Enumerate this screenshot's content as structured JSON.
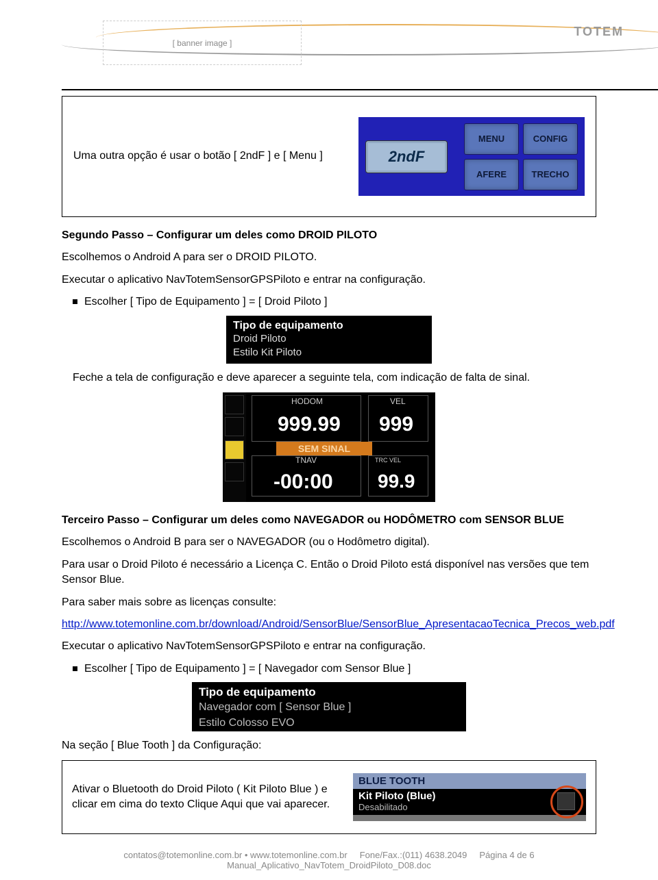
{
  "header": {
    "brand": "TOTEM",
    "logo_placeholder": "[ banner image ]"
  },
  "section1": {
    "title_text": "Uma outra opção é usar o botão [ 2ndF ] e [ Menu ]",
    "btn_2ndf": "2ndF",
    "menu_buttons": {
      "tl": "MENU",
      "tr": "CONFIG",
      "bl": "AFERE",
      "br": "TRECHO"
    }
  },
  "passo2": {
    "heading": "Segundo Passo – Configurar um deles como DROID PILOTO",
    "line1": "Escolhemos o Android A para ser o DROID PILOTO.",
    "line2": "Executar o aplicativo NavTotemSensorGPSPiloto e entrar na configuração.",
    "bullet1": "Escolher [ Tipo de Equipamento ] = [ Droid Piloto ]",
    "tipo1": {
      "title": "Tipo de equipamento",
      "opt1": "Droid Piloto",
      "opt2": "Estilo Kit Piloto"
    },
    "line3": "Feche a tela de configuração e deve aparecer a seguinte tela, com indicação de falta de sinal."
  },
  "display": {
    "hodom_label": "HODOM",
    "hodom_value": "999.99",
    "vel_label": "VEL",
    "vel_value": "999",
    "sem_sinal": "SEM SINAL",
    "tnav_label": "TNAV",
    "tnav_value": "-00:00",
    "trcvel_label": "TRC VEL",
    "trcvel_value": "99.9"
  },
  "passo3": {
    "heading": "Terceiro Passo – Configurar um deles como NAVEGADOR ou HODÔMETRO com SENSOR BLUE",
    "line1": "Escolhemos o Android B para ser o NAVEGADOR (ou o Hodômetro digital).",
    "line2": "Para usar o Droid Piloto é necessário a Licença C. Então o Droid Piloto está disponível nas versões que tem Sensor Blue.",
    "line3": "Para saber mais sobre as licenças consulte:",
    "link": "http://www.totemonline.com.br/download/Android/SensorBlue/SensorBlue_ApresentacaoTecnica_Precos_web.pdf",
    "line4": "Executar o aplicativo NavTotemSensorGPSPiloto e entrar na configuração.",
    "bullet1": "Escolher [ Tipo de Equipamento ] = [ Navegador com Sensor Blue ]",
    "tipo2": {
      "title": "Tipo de equipamento",
      "opt1": "Navegador com [ Sensor Blue ]",
      "opt2": "Estilo Colosso EVO"
    },
    "line5": "Na seção [ Blue Tooth ] da Configuração:"
  },
  "bluetooth_box": {
    "text": "Ativar o Bluetooth do Droid Piloto ( Kit Piloto Blue ) e clicar em cima do texto Clique Aqui que vai aparecer.",
    "header": "BLUE TOOTH",
    "name": "Kit Piloto (Blue)",
    "status": "Desabilitado"
  },
  "footer": {
    "contacts": "contatos@totemonline.com.br • www.totemonline.com.br",
    "fone": "Fone/Fax.:(011) 4638.2049",
    "page": "Página 4 de 6",
    "filename": "Manual_Aplicativo_NavTotem_DroidPiloto_D08.doc"
  }
}
